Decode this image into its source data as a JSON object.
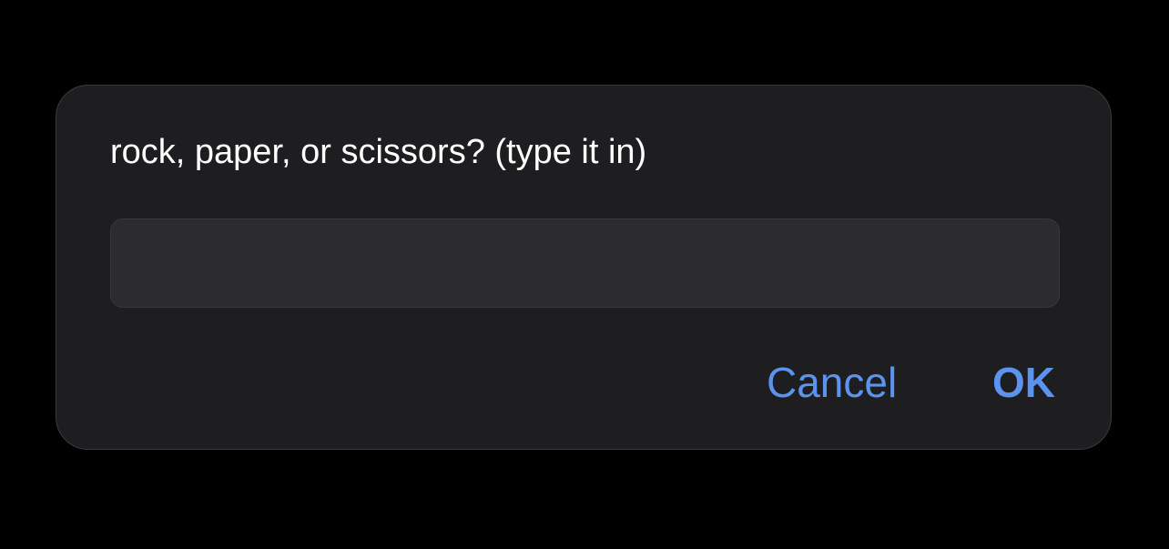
{
  "dialog": {
    "prompt": "rock, paper, or scissors? (type it in)",
    "input": {
      "value": "",
      "placeholder": ""
    },
    "buttons": {
      "cancel_label": "Cancel",
      "ok_label": "OK"
    }
  },
  "colors": {
    "background": "#000000",
    "dialog": "#1e1e20",
    "input": "#2c2c2e",
    "text": "#ffffff",
    "accent": "#5b93ee"
  }
}
